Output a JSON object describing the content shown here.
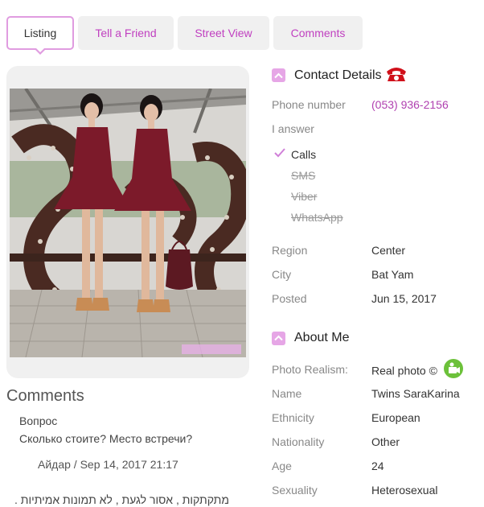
{
  "tabs": [
    {
      "label": "Listing",
      "active": true
    },
    {
      "label": "Tell a Friend",
      "active": false
    },
    {
      "label": "Street View",
      "active": false
    },
    {
      "label": "Comments",
      "active": false
    }
  ],
  "contact": {
    "title": "Contact Details",
    "phone_label": "Phone number",
    "phone_value": "(053) 936-2156",
    "answer_label": "I answer",
    "answers": [
      {
        "label": "Calls",
        "enabled": true
      },
      {
        "label": "SMS",
        "enabled": false
      },
      {
        "label": "Viber",
        "enabled": false
      },
      {
        "label": "WhatsApp",
        "enabled": false
      }
    ],
    "region_label": "Region",
    "region_value": "Center",
    "city_label": "City",
    "city_value": "Bat Yam",
    "posted_label": "Posted",
    "posted_value": "Jun 15, 2017"
  },
  "about": {
    "title": "About Me",
    "realism_label": "Photo Realism:",
    "realism_value": "Real photo ©",
    "name_label": "Name",
    "name_value": "Twins SaraKarina",
    "ethnicity_label": "Ethnicity",
    "ethnicity_value": "European",
    "nationality_label": "Nationality",
    "nationality_value": "Other",
    "age_label": "Age",
    "age_value": "24",
    "sexuality_label": "Sexuality",
    "sexuality_value": "Heterosexual"
  },
  "comments": {
    "title": "Comments",
    "items": [
      {
        "subject": "Вопрос",
        "body": "Сколько стоите? Место встречи?",
        "meta": "Айдар / Sep 14, 2017 21:17"
      }
    ],
    "extra_text": "מתקתקות , אסור לגעת , לא תמונות אמיתיות ."
  },
  "colors": {
    "accent": "#b040b0",
    "tab_text": "#c040c0",
    "chevron_bg": "#e6a6e6",
    "phone_icon": "#d0101a",
    "camera_icon": "#6cc13a"
  }
}
